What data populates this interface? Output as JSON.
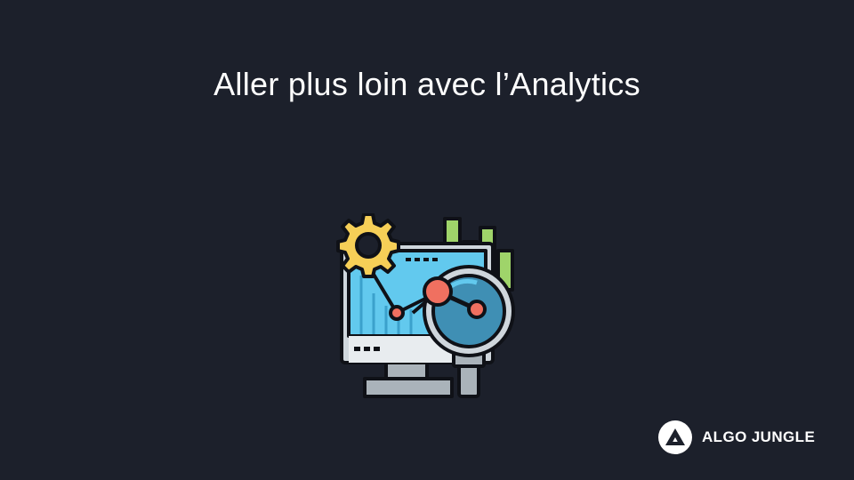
{
  "slide": {
    "title": "Aller plus loin avec l’Analytics"
  },
  "illustration": {
    "icon": "analytics-monitor-icon",
    "colors": {
      "outline": "#0f1117",
      "screen": "#62c9ee",
      "screen_lines": "#3ba1cc",
      "gear": "#f6cf57",
      "bars": "#9fd46a",
      "lens": "#3f8fb4",
      "lens_ring": "#cfd6dc",
      "node": "#f07060",
      "stand": "#aab3ba"
    }
  },
  "brand": {
    "name": "ALGO JUNGLE",
    "logo_icon": "algo-jungle-logo-icon"
  },
  "theme": {
    "background": "#1c202b",
    "text": "#ffffff"
  }
}
